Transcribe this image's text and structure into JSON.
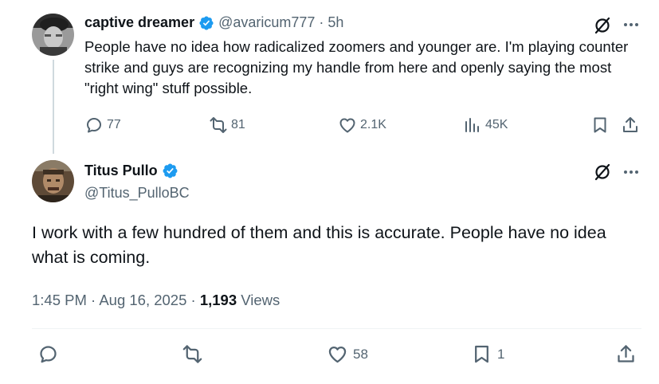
{
  "quoted": {
    "author_name": "captive dreamer",
    "author_handle": "@avaricum777",
    "separator": "·",
    "time_ago": "5h",
    "text": "People have no idea how radicalized zoomers and younger are.  I'm playing counter strike and guys are recognizing my handle from here and openly saying the most \"right wing\" stuff possible.",
    "replies": "77",
    "reposts": "81",
    "likes": "2.1K",
    "views": "45K"
  },
  "main": {
    "author_name": "Titus Pullo",
    "author_handle": "@Titus_PulloBC",
    "text": "I work with a few hundred of them and this is accurate.   People have no idea what is coming.",
    "timestamp": "1:45 PM · Aug 16, 2025 · ",
    "views_count": "1,193",
    "views_label": " Views",
    "likes": "58",
    "bookmarks": "1"
  },
  "colors": {
    "text": "#0f1419",
    "muted": "#536471",
    "verified": "#1d9bf0",
    "divider": "#eff3f4",
    "thread_line": "#cfd9de"
  },
  "icons": [
    "verified-badge-icon",
    "grok-icon",
    "more-icon",
    "reply-icon",
    "repost-icon",
    "like-icon",
    "views-icon",
    "bookmark-icon",
    "share-icon"
  ]
}
